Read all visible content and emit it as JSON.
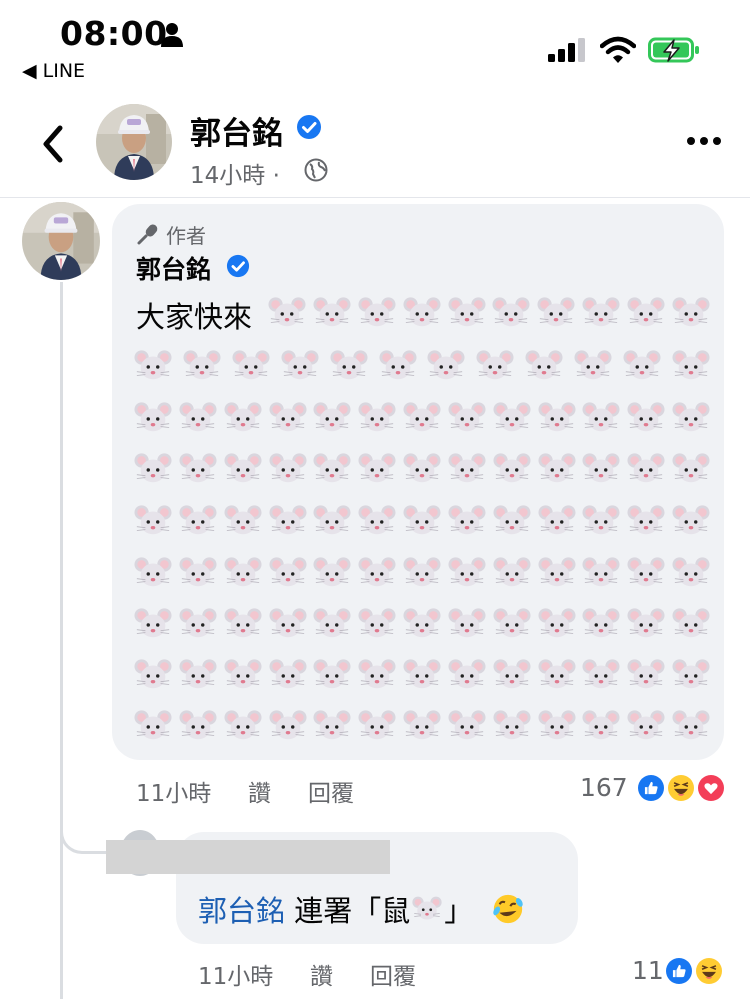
{
  "status_bar": {
    "time": "08:00",
    "back_app_label": "◀ LINE"
  },
  "header": {
    "name": "郭台銘",
    "meta": "14小時 ·"
  },
  "comment": {
    "author_badge": "作者",
    "name": "郭台銘",
    "text": "大家快來",
    "emoji_rows": [
      10,
      12,
      13,
      13,
      13,
      13,
      13,
      13,
      13
    ],
    "time": "11小時",
    "like": "讚",
    "reply": "回覆",
    "reaction_count": "167",
    "reactions": [
      "like",
      "haha",
      "love"
    ]
  },
  "reply": {
    "mention": "郭台銘",
    "text": "連署「鼠",
    "text_end": "」",
    "time": "11小時",
    "like": "讚",
    "reply": "回覆",
    "reaction_count": "11",
    "reactions": [
      "like",
      "haha"
    ]
  },
  "colors": {
    "accent": "#1877f2",
    "bubble": "#f0f2f5",
    "muted_text": "#65676b",
    "battery_green": "#34c759"
  }
}
